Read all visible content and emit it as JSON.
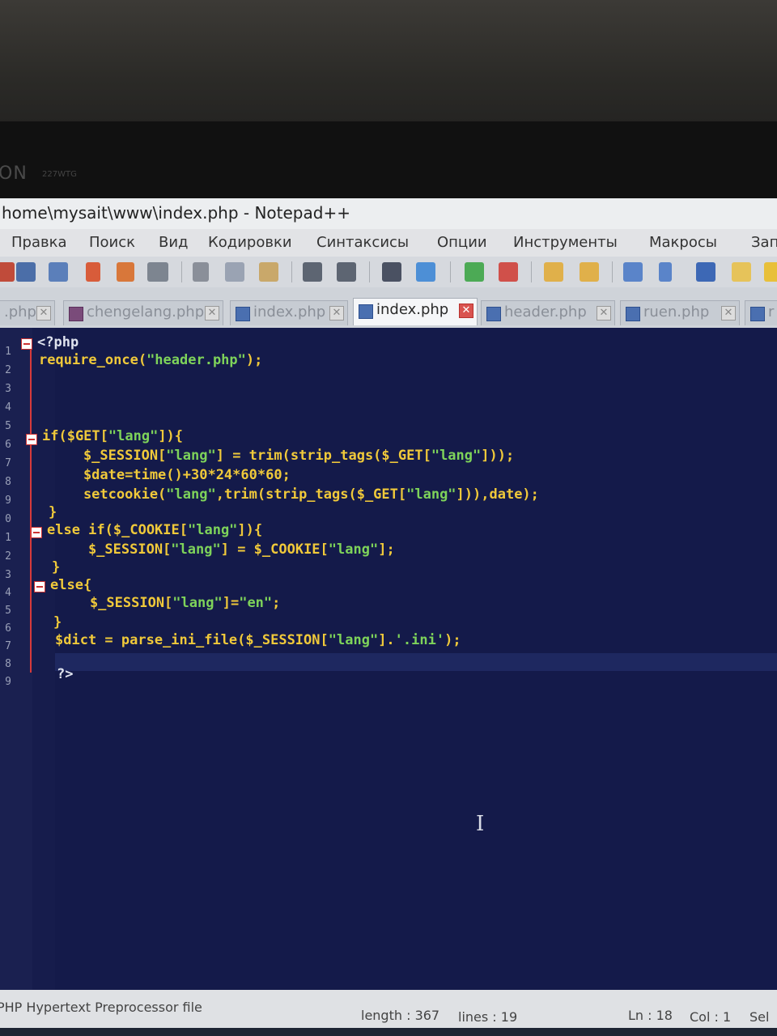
{
  "monitor": {
    "brand": "ON",
    "model": "227WTG"
  },
  "window": {
    "title": "home\\mysait\\www\\index.php - Notepad++"
  },
  "menu": [
    "Правка",
    "Поиск",
    "Вид",
    "Кодировки",
    "Синтаксисы",
    "Опции",
    "Инструменты",
    "Макросы",
    "Зап"
  ],
  "toolbar": [
    "save-icon",
    "save-all-icon",
    "close-icon",
    "close-all-icon",
    "print-icon",
    "cut-icon",
    "copy-icon",
    "paste-icon",
    "undo-icon",
    "redo-icon",
    "find-icon",
    "replace-icon",
    "zoom-in-icon",
    "zoom-out-icon",
    "sync-v-icon",
    "sync-h-icon",
    "word-wrap-icon",
    "show-all-chars-icon",
    "indent-guide-icon",
    "folder-icon",
    "macro-icon"
  ],
  "tabs": [
    {
      "label": ".php",
      "active": false
    },
    {
      "label": "chengelang.php",
      "active": false
    },
    {
      "label": "index.php",
      "active": false
    },
    {
      "label": "index.php",
      "active": true
    },
    {
      "label": "header.php",
      "active": false
    },
    {
      "label": "ruen.php",
      "active": false
    },
    {
      "label": "r",
      "active": false
    }
  ],
  "close_glyph": "✕",
  "line_numbers": [
    "1",
    "2",
    "3",
    "4",
    "5",
    "6",
    "7",
    "8",
    "9",
    "0",
    "1",
    "2",
    "3",
    "4",
    "5",
    "6",
    "7",
    "8",
    "9"
  ],
  "code": [
    "<?php",
    "require_once(\"header.php\");",
    "",
    "",
    "",
    "if($GET[\"lang\"]){",
    "    $_SESSION[\"lang\"] = trim(strip_tags($_GET[\"lang\"]));",
    "    $date=time()+30*24*60*60;",
    "    setcookie(\"lang\",trim(strip_tags($_GET[\"lang\"])),date);",
    "}",
    "else if($_COOKIE[\"lang\"]){",
    "    $_SESSION[\"lang\"] = $_COOKIE[\"lang\"];",
    "}",
    "else{",
    "    $_SESSION[\"lang\"]=\"en\";",
    "}",
    "$dict = parse_ini_file($_SESSION[\"lang\"].'.ini');",
    "",
    "?>"
  ],
  "cursor_glyph": "I",
  "status": {
    "file_type": "PHP Hypertext Preprocessor file",
    "length": "length : 367",
    "lines": "lines : 19",
    "ln": "Ln : 18",
    "col": "Col : 1",
    "sel": "Sel"
  }
}
